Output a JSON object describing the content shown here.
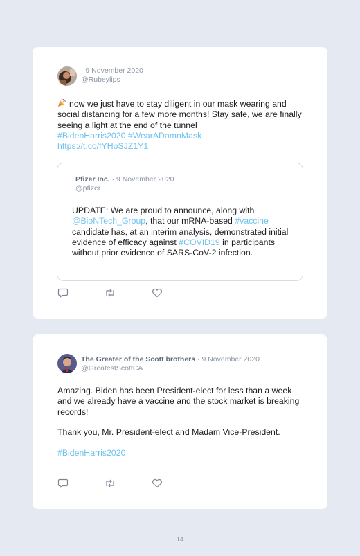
{
  "tweet1": {
    "date": "9 November 2020",
    "handle": "@Rubeylips",
    "text_main": "now we just have to stay diligent in our mask wearing and social distancing for a few more months! Stay safe, we are finally seeing a light at the end of the tunnel",
    "hashtag1": "#BidenHarris2020",
    "hashtag2": "#WearADamnMask",
    "link": "https://t.co/fYHoSJZ1Y1",
    "quoted": {
      "name": "Pfizer Inc.",
      "date": "9 November 2020",
      "handle": "@pfizer",
      "text_1": "UPDATE: We are proud to announce, along with",
      "mention": "@BioNTech_Group",
      "text_2": ", that our mRNA-based",
      "hashtag_vaccine": "#vaccine",
      "text_3": "candidate has, at an interim analysis, demonstrated initial evidence of efficacy against",
      "hashtag_covid": "#COVID19",
      "text_4": "in participants without prior evidence of SARS-CoV-2 infection."
    }
  },
  "tweet2": {
    "name": "The Greater of the Scott brothers",
    "date": "9 November 2020",
    "handle": "@GreatestScottCA",
    "paragraph1": "Amazing. Biden has been President-elect for less than a week and we already have a vaccine and the stock market is breaking records!",
    "paragraph2": "Thank you, Mr. President-elect and Madam Vice-President.",
    "hashtag": "#BidenHarris2020"
  },
  "page_number": "14",
  "icons": [
    "party-popper-icon",
    "reply-icon",
    "retweet-icon",
    "like-icon"
  ],
  "colors": {
    "link": "#6ec2ee",
    "background": "#e4e9f2",
    "card": "#ffffff"
  }
}
